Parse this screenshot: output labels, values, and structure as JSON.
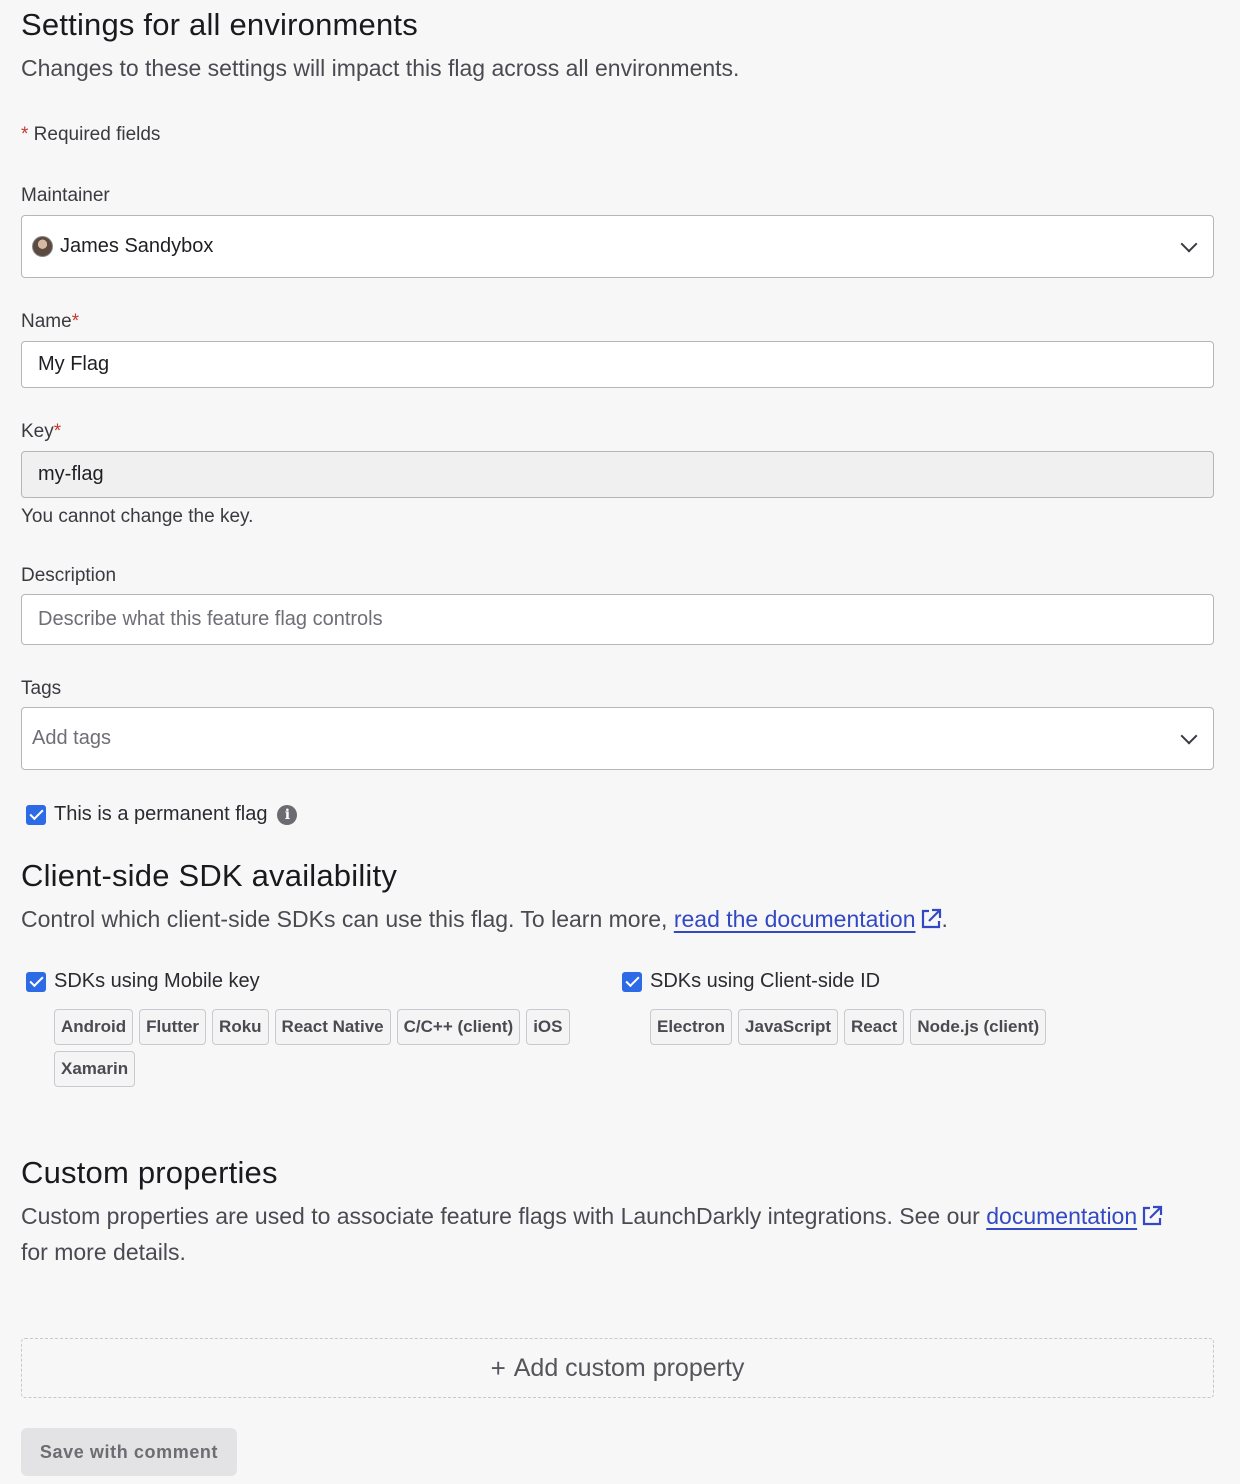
{
  "settings": {
    "title": "Settings for all environments",
    "subtitle": "Changes to these settings will impact this flag across all environments.",
    "required_marker": "*",
    "required_note": " Required fields"
  },
  "maintainer": {
    "label": "Maintainer",
    "value": "James Sandybox"
  },
  "name": {
    "label": "Name",
    "required": "*",
    "value": "My Flag"
  },
  "key": {
    "label": "Key",
    "required": "*",
    "value": "my-flag",
    "help": "You cannot change the key."
  },
  "description": {
    "label": "Description",
    "placeholder": "Describe what this feature flag controls"
  },
  "tags": {
    "label": "Tags",
    "placeholder": "Add tags"
  },
  "permanent": {
    "label": "This is a permanent flag",
    "checked": true,
    "info_glyph": "i"
  },
  "sdk": {
    "title": "Client-side SDK availability",
    "text_before": "Control which client-side SDKs can use this flag. To learn more, ",
    "link": "read the documentation",
    "text_after": ".",
    "mobile": {
      "label": "SDKs using Mobile key",
      "checked": true,
      "chips": [
        "Android",
        "Flutter",
        "Roku",
        "React Native",
        "C/C++ (client)",
        "iOS",
        "Xamarin"
      ]
    },
    "client": {
      "label": "SDKs using Client-side ID",
      "checked": true,
      "chips": [
        "Electron",
        "JavaScript",
        "React",
        "Node.js (client)"
      ]
    }
  },
  "custom": {
    "title": "Custom properties",
    "text_before": "Custom properties are used to associate feature flags with LaunchDarkly integrations. See our ",
    "link": "documentation",
    "text_after": " for more details.",
    "add_icon": "+",
    "add_label": "Add custom property"
  },
  "save": {
    "label": "Save with comment"
  },
  "colors": {
    "accent": "#2d6ae6",
    "link": "#3349c4",
    "required": "#c23a2b"
  },
  "icons": {
    "maintainer_avatar": "avatar",
    "chevron": "chevron-down-icon",
    "info": "info-icon",
    "external": "external-link-icon",
    "plus": "plus-icon"
  }
}
